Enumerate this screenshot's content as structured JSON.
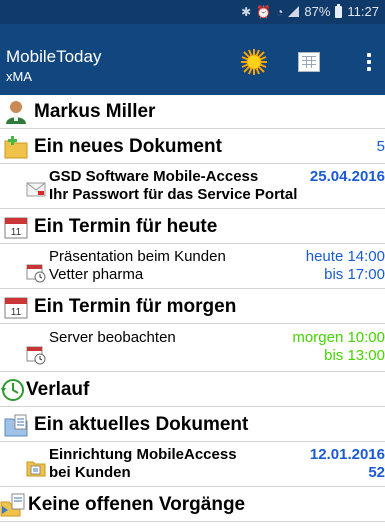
{
  "status_bar": {
    "icons": [
      "bluetooth-icon",
      "alarm-icon",
      "wifi-icon",
      "signal-icon",
      "battery-icon"
    ],
    "battery": "87%",
    "time": "11:27"
  },
  "app_bar": {
    "title": "MobileToday",
    "subtitle": "xMA",
    "actions": [
      "star-icon",
      "list-view-icon",
      "overflow-menu-icon"
    ]
  },
  "user": {
    "name": "Markus Miller",
    "icon": "user-icon"
  },
  "sections": {
    "new_document": {
      "title": "Ein neues Dokument",
      "count": "5",
      "icon": "folder-new-icon",
      "item": {
        "line1": "GSD Software Mobile-Access",
        "line2": "Ihr Passwort für das Service Portal",
        "date": "25.04.2016",
        "icon": "mail-icon"
      }
    },
    "appointment_today": {
      "title": "Ein Termin für heute",
      "icon": "calendar-icon",
      "item": {
        "line1": "Präsentation beim Kunden",
        "line2": "Vetter pharma",
        "start": "heute 14:00",
        "end": "bis 17:00",
        "icon": "appointment-icon"
      }
    },
    "appointment_tomorrow": {
      "title": "Ein Termin für morgen",
      "icon": "calendar-icon",
      "item": {
        "line1": "Server beobachten",
        "start": "morgen 10:00",
        "end": "bis 13:00",
        "icon": "appointment-icon"
      }
    },
    "history": {
      "title": "Verlauf",
      "icon": "history-icon"
    },
    "current_document": {
      "title": "Ein aktuelles Dokument",
      "icon": "document-icon",
      "item": {
        "line1": "Einrichtung MobileAccess",
        "line2": "bei Kunden",
        "date": "12.01.2016",
        "count": "52",
        "icon": "folder-document-icon"
      }
    },
    "open_tasks": {
      "title": "Keine offenen Vorgänge",
      "icon": "tasks-icon"
    }
  },
  "colors": {
    "status_bar": "#0f3a69",
    "app_bar": "#11467f",
    "accent_blue": "#1a5bd3",
    "accent_green": "#45d400"
  }
}
